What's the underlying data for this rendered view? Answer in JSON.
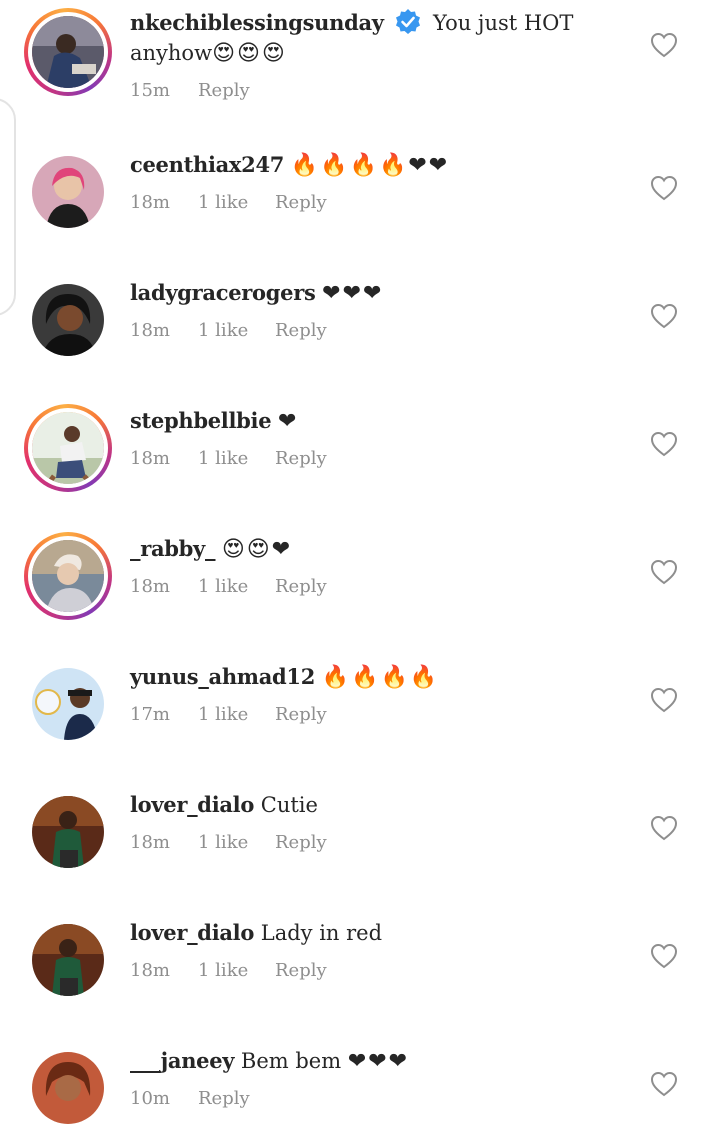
{
  "comments": [
    {
      "username": "nkechiblessingsunday",
      "verified": true,
      "text": "You just HOT anyhow",
      "emoji": "😍😍😍",
      "time": "15m",
      "likes": "",
      "reply": "Reply"
    },
    {
      "username": "ceenthiax247",
      "verified": false,
      "text": "",
      "emoji": "🔥🔥🔥🔥❤❤",
      "time": "18m",
      "likes": "1 like",
      "reply": "Reply"
    },
    {
      "username": "ladygracerogers",
      "verified": false,
      "text": "",
      "emoji": "❤❤❤",
      "time": "18m",
      "likes": "1 like",
      "reply": "Reply"
    },
    {
      "username": "stephbellbie",
      "verified": false,
      "text": "",
      "emoji": "❤",
      "time": "18m",
      "likes": "1 like",
      "reply": "Reply"
    },
    {
      "username": "_rabby_",
      "verified": false,
      "text": "",
      "emoji": "😍😍❤",
      "time": "18m",
      "likes": "1 like",
      "reply": "Reply"
    },
    {
      "username": "yunus_ahmad12",
      "verified": false,
      "text": "",
      "emoji": "🔥🔥🔥🔥",
      "time": "17m",
      "likes": "1 like",
      "reply": "Reply"
    },
    {
      "username": "lover_dialo",
      "verified": false,
      "text": "Cutie",
      "emoji": "",
      "time": "18m",
      "likes": "1 like",
      "reply": "Reply"
    },
    {
      "username": "lover_dialo",
      "verified": false,
      "text": "Lady in red",
      "emoji": "",
      "time": "18m",
      "likes": "1 like",
      "reply": "Reply"
    },
    {
      "username": "___janeey",
      "verified": false,
      "text": "Bem bem",
      "emoji": "❤❤❤",
      "time": "10m",
      "likes": "",
      "reply": "Reply"
    }
  ],
  "icons": {
    "like": "heart-outline-icon",
    "verified": "verified-badge-icon"
  },
  "colors": {
    "text": "#262626",
    "muted": "#8e8e8e",
    "verified": "#3897f0",
    "heart": "#e0132e",
    "story_ring_start": "#c13584",
    "story_ring_end": "#fcaf45"
  }
}
